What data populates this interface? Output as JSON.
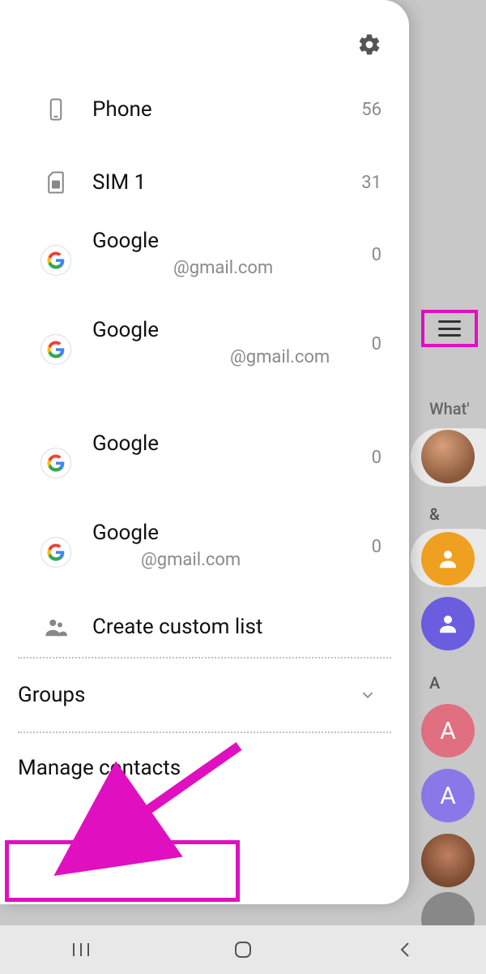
{
  "background": {
    "whats_label": "What'",
    "amp_label": "&",
    "letter_header": "A",
    "avatar_letters": [
      "A",
      "A"
    ]
  },
  "drawer": {
    "sources": [
      {
        "title": "Phone",
        "sub": "",
        "count": "56"
      },
      {
        "title": "SIM 1",
        "sub": "",
        "count": "31"
      },
      {
        "title": "Google",
        "sub": "@gmail.com",
        "count": "0"
      },
      {
        "title": "Google",
        "sub": "@gmail.com",
        "count": "0"
      },
      {
        "title": "Google",
        "sub": "",
        "count": "0"
      },
      {
        "title": "Google",
        "sub": "@gmail.com",
        "count": "0"
      }
    ],
    "create_custom_list": "Create custom list",
    "groups_label": "Groups",
    "manage_contacts_label": "Manage contacts"
  }
}
